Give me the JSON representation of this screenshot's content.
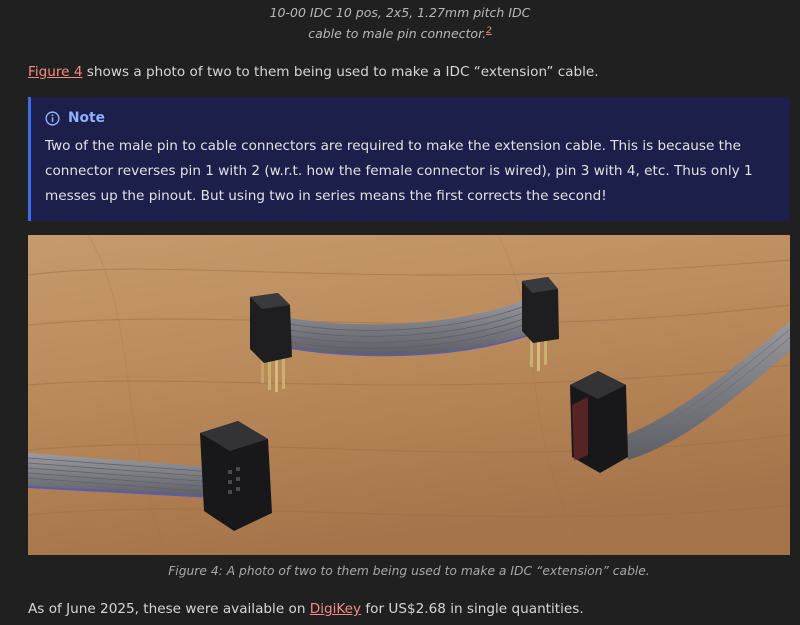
{
  "top_caption": {
    "line1": "10-00 IDC 10 pos, 2x5, 1.27mm pitch IDC",
    "line2": "cable to male pin connector.",
    "footnote": "2"
  },
  "paragraph1": {
    "link": "Figure 4",
    "text": " shows a photo of two to them being used to make a IDC “extension” cable."
  },
  "note": {
    "icon": "info-circle-icon",
    "title": "Note",
    "body": "Two of the male pin to cable connectors are required to make the extension cable. This is because the connector reverses pin 1 with 2 (w.r.t. how the female connector is wired), pin 3 with 4, etc. Thus only 1 messes up the pinout. But using two in series means the first corrects the second!"
  },
  "figure": {
    "caption": "Figure 4: A photo of two to them being used to make a IDC “extension” cable."
  },
  "paragraph2": {
    "prefix": "As of June 2025, these were available on ",
    "link": "DigiKey",
    "suffix": " for US$2.68 in single quantities."
  },
  "colors": {
    "background": "#202020",
    "link": "#f58a82",
    "note_background": "#1c1f4a",
    "note_accent": "#3f6ce6",
    "note_title": "#8fb2ff"
  }
}
